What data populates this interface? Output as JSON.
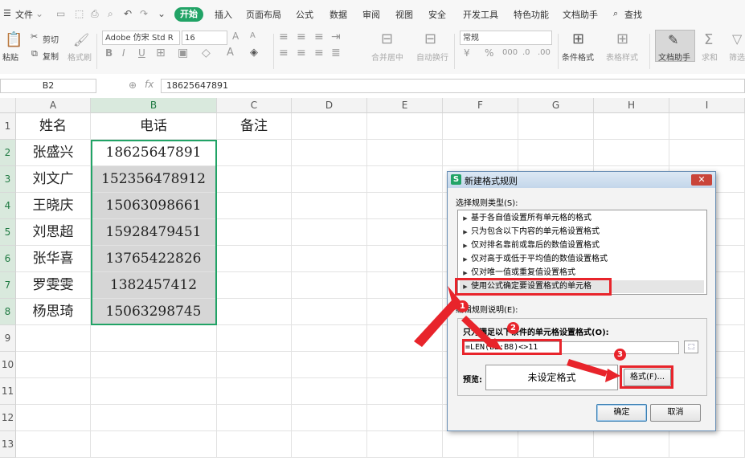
{
  "menu": {
    "file": "文件",
    "tabs": [
      "开始",
      "插入",
      "页面布局",
      "公式",
      "数据",
      "审阅",
      "视图",
      "安全",
      "开发工具",
      "特色功能",
      "文档助手"
    ],
    "active_tab": "开始",
    "search": "查找"
  },
  "toolbar": {
    "paste": "粘贴",
    "cut": "剪切",
    "copy": "复制",
    "format_painter": "格式刷",
    "font_name": "Adobe 仿宋 Std R",
    "font_size": "16",
    "merge_center": "合并居中",
    "auto_wrap": "自动换行",
    "number_format": "常规",
    "conditional_format": "条件格式",
    "table_style": "表格样式",
    "doc_helper": "文档助手",
    "sum": "求和",
    "filter": "筛选"
  },
  "formula_bar": {
    "name_box": "B2",
    "fx": "fx",
    "value": "18625647891"
  },
  "sheet": {
    "columns": [
      "A",
      "B",
      "C",
      "D",
      "E",
      "F",
      "G",
      "H",
      "I"
    ],
    "rows": [
      "1",
      "2",
      "3",
      "4",
      "5",
      "6",
      "7",
      "8",
      "9",
      "10",
      "11",
      "12",
      "13"
    ],
    "headers": [
      "姓名",
      "电话",
      "备注"
    ],
    "data": [
      [
        "张盛兴",
        "18625647891"
      ],
      [
        "刘文广",
        "152356478912"
      ],
      [
        "王晓庆",
        "15063098661"
      ],
      [
        "刘思超",
        "15928479451"
      ],
      [
        "张华喜",
        "13765422826"
      ],
      [
        "罗雯雯",
        "1382457412"
      ],
      [
        "杨思琦",
        "15063298745"
      ]
    ]
  },
  "dialog": {
    "title": "新建格式规则",
    "rule_type_label": "选择规则类型(S):",
    "rule_types": [
      "基于各自值设置所有单元格的格式",
      "只为包含以下内容的单元格设置格式",
      "仅对排名靠前或靠后的数值设置格式",
      "仅对高于或低于平均值的数值设置格式",
      "仅对唯一值或重复值设置格式",
      "使用公式确定要设置格式的单元格"
    ],
    "selected_rule": 5,
    "desc_label": "编辑规则说明(E):",
    "formula_label": "只为满足以下条件的单元格设置格式(O):",
    "formula": "=LEN(B2:B8)<>11",
    "preview_label": "预览:",
    "preview_text": "未设定格式",
    "format_button": "格式(F)...",
    "ok": "确定",
    "cancel": "取消"
  },
  "annotations": {
    "accent": "#e8242b",
    "badges": [
      "1",
      "2",
      "3"
    ]
  }
}
